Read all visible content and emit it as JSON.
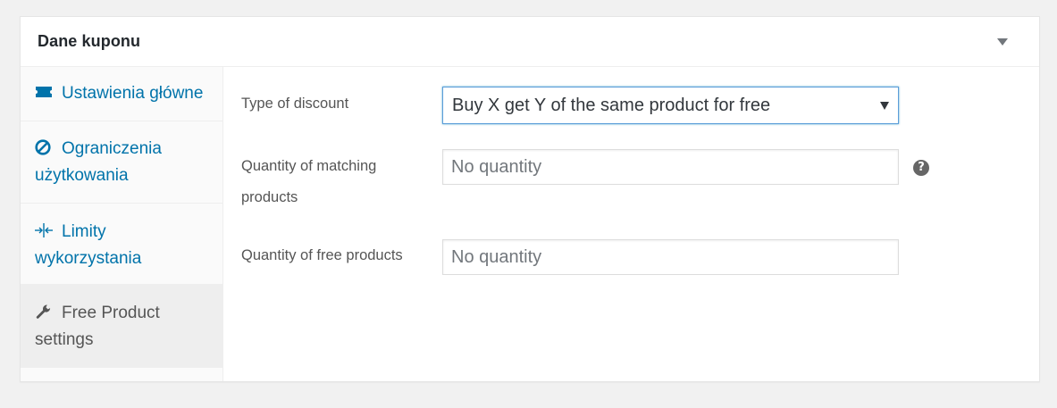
{
  "postbox": {
    "title": "Dane kuponu"
  },
  "tabs": [
    {
      "label": "Ustawienia główne",
      "icon": "ticket-icon",
      "active": false
    },
    {
      "label": "Ograniczenia użytkowania",
      "icon": "no-entry-icon",
      "active": false
    },
    {
      "label": "Limity wykorzystania",
      "icon": "arrows-in-icon",
      "active": false
    },
    {
      "label": "Free Product settings",
      "icon": "wrench-icon",
      "active": true
    }
  ],
  "fields": {
    "discount_type": {
      "label": "Type of discount",
      "value": "Buy X get Y of the same product for free"
    },
    "matching_qty": {
      "label": "Quantity of matching products",
      "placeholder": "No quantity",
      "help": "?"
    },
    "free_qty": {
      "label": "Quantity of free products",
      "placeholder": "No quantity"
    }
  },
  "colors": {
    "link": "#0073aa",
    "active_tab_text": "#555555",
    "focus_border": "#5b9dd9"
  }
}
